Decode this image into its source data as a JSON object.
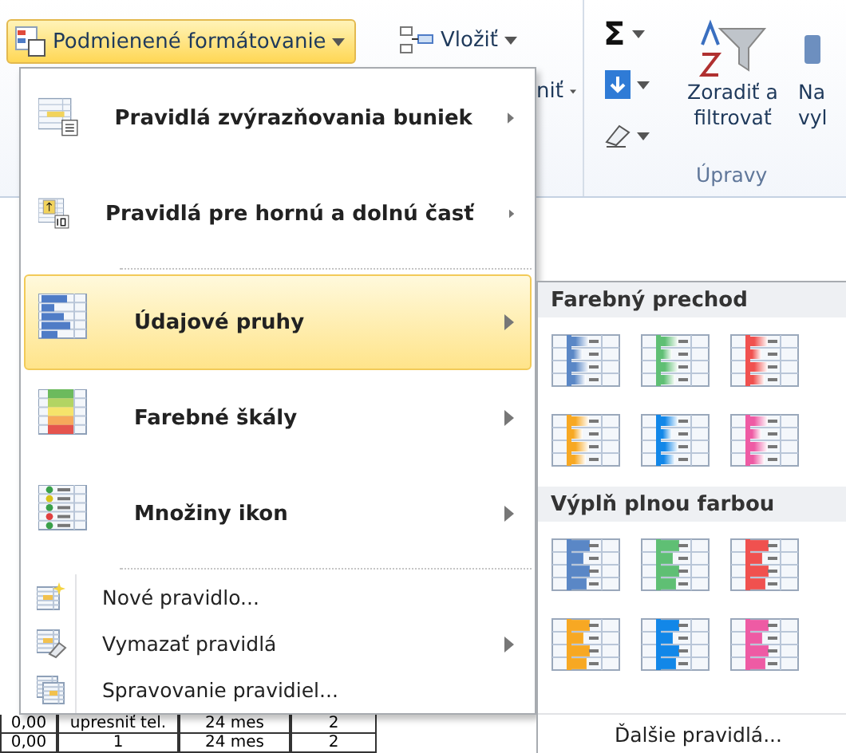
{
  "ribbon": {
    "conditional_formatting": {
      "label": "Podmienené formátovanie",
      "selected": true
    },
    "insert": {
      "label": "Vložiť"
    },
    "format_partial": {
      "label": "niť"
    },
    "autosum": {
      "symbol": "Σ"
    },
    "sort_filter": {
      "label_lines": [
        "Zoradiť a",
        "filtrovať"
      ]
    },
    "partial_button": {
      "label_lines": [
        "Na",
        "vyl"
      ]
    },
    "group_label": "Úpravy"
  },
  "menu": {
    "items": [
      {
        "kind": "large",
        "label": "Pravidlá zvýrazňovania buniek",
        "submenu": true,
        "selected": false
      },
      {
        "kind": "large",
        "label": "Pravidlá pre hornú a dolnú časť",
        "submenu": true,
        "selected": false
      },
      {
        "kind": "separator"
      },
      {
        "kind": "large",
        "label": "Údajové pruhy",
        "submenu": true,
        "selected": true
      },
      {
        "kind": "large",
        "label": "Farebné škály",
        "submenu": true,
        "selected": false
      },
      {
        "kind": "large",
        "label": "Množiny ikon",
        "submenu": true,
        "selected": false
      },
      {
        "kind": "separator"
      },
      {
        "kind": "small",
        "label": "Nové pravidlo...",
        "submenu": false,
        "selected": false
      },
      {
        "kind": "small",
        "label": "Vymazať pravidlá",
        "submenu": true,
        "selected": false
      },
      {
        "kind": "small",
        "label": "Spravovanie pravidiel...",
        "submenu": false,
        "selected": false
      }
    ]
  },
  "submenu": {
    "sections": [
      {
        "title": "Farebný prechod",
        "swatches": [
          {
            "kind": "gradient",
            "color": "#5a87c6"
          },
          {
            "kind": "gradient",
            "color": "#5fbf74"
          },
          {
            "kind": "gradient",
            "color": "#f0514f"
          },
          {
            "kind": "gradient",
            "color": "#f7a823"
          },
          {
            "kind": "gradient",
            "color": "#1287e8"
          },
          {
            "kind": "gradient",
            "color": "#ee5ba4"
          }
        ]
      },
      {
        "title": "Výplň plnou farbou",
        "swatches": [
          {
            "kind": "solid",
            "color": "#5a87c6"
          },
          {
            "kind": "solid",
            "color": "#5fbf74"
          },
          {
            "kind": "solid",
            "color": "#f0514f"
          },
          {
            "kind": "solid",
            "color": "#f7a823"
          },
          {
            "kind": "solid",
            "color": "#1287e8"
          },
          {
            "kind": "solid",
            "color": "#ee5ba4"
          }
        ]
      }
    ],
    "more": "Ďalšie pravidlá..."
  },
  "sheet": {
    "rows": [
      [
        "0,00",
        "upresniť tel.",
        "24 mes",
        "2"
      ],
      [
        "0,00",
        "1",
        "24 mes",
        "2"
      ]
    ]
  }
}
